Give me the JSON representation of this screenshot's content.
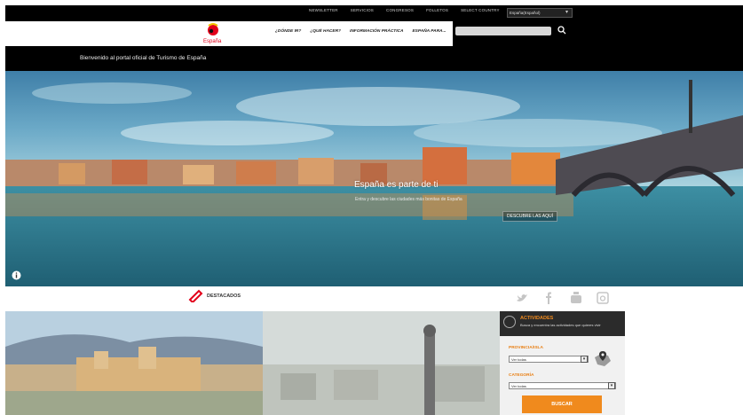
{
  "topbar": {
    "links": [
      "NEWSLETTER",
      "SERVICIOS",
      "CONGRESOS",
      "FOLLETOS",
      "SELECT COUNTRY"
    ],
    "language": "España(Español)"
  },
  "header": {
    "logo_text": "España",
    "nav": [
      "¿DÓNDE IR?",
      "¿QUÉ HACER?",
      "INFORMACIÓN PRÁCTICA",
      "ESPAÑA PARA..."
    ],
    "search_placeholder": ""
  },
  "welcome": "Bienvenido al portal oficial de Turismo de España",
  "hero": {
    "title": "España es parte de ti",
    "subtitle": "Entra y descubre las ciudades más bonitas de España",
    "button": "DESCUBRE LAS AQUÍ"
  },
  "destacados": {
    "label": "DESTACADOS"
  },
  "social": [
    "twitter-icon",
    "facebook-icon",
    "youtube-icon",
    "instagram-icon"
  ],
  "activities": {
    "title": "ACTIVIDADES",
    "description": "Busca y encuentra las actividades que quieres vivir",
    "province_label": "PROVINCIA/ISLA",
    "province_value": "Ver todas",
    "category_label": "CATEGORÍA",
    "category_value": "Ver todas",
    "button": "BUSCAR"
  },
  "colors": {
    "accent": "#f08a1d",
    "brand_red": "#e2001a"
  }
}
